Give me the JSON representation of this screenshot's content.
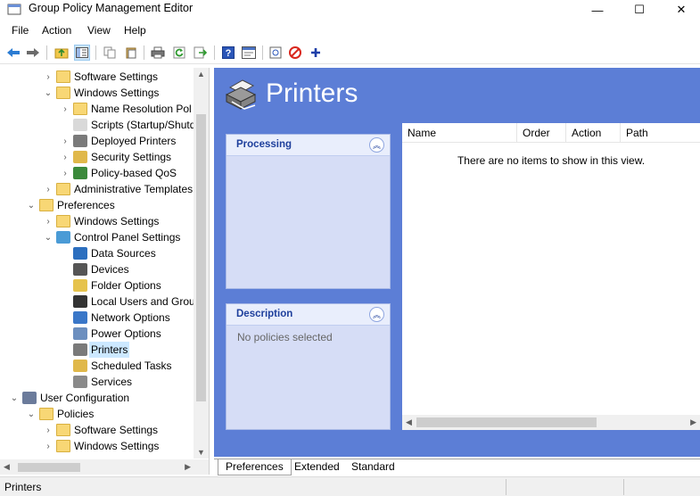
{
  "window": {
    "title": "Group Policy Management Editor",
    "minimize_glyph": "—",
    "maximize_glyph": "☐",
    "close_glyph": "✕"
  },
  "menu": [
    "File",
    "Action",
    "View",
    "Help"
  ],
  "toolbar": {
    "icons": [
      "back-icon",
      "forward-icon",
      "up-folder-icon",
      "show-hide-tree-icon",
      "copy-icon",
      "paste-icon",
      "print-icon",
      "refresh-icon",
      "export-icon",
      "help-icon",
      "properties-icon",
      "new-item-icon",
      "stop-icon",
      "add-icon"
    ]
  },
  "tree": {
    "items": [
      {
        "label": "Software Settings",
        "icon": "folder-icon",
        "expander": "›"
      },
      {
        "label": "Windows Settings",
        "icon": "folder-icon",
        "expander": "⌄"
      },
      {
        "label": "Name Resolution Pol",
        "icon": "folder-icon",
        "expander": "›"
      },
      {
        "label": "Scripts (Startup/Shutd",
        "icon": "script-icon",
        "expander": ""
      },
      {
        "label": "Deployed Printers",
        "icon": "printer-icon",
        "expander": "›"
      },
      {
        "label": "Security Settings",
        "icon": "security-icon",
        "expander": "›"
      },
      {
        "label": "Policy-based QoS",
        "icon": "chart-icon",
        "expander": "›"
      },
      {
        "label": "Administrative Templates",
        "icon": "folder-icon",
        "expander": "›"
      },
      {
        "label": "Preferences",
        "icon": "folder-icon",
        "expander": "⌄"
      },
      {
        "label": "Windows Settings",
        "icon": "folder-icon",
        "expander": "›"
      },
      {
        "label": "Control Panel Settings",
        "icon": "control-panel-icon",
        "expander": "⌄"
      },
      {
        "label": "Data Sources",
        "icon": "data-sources-icon",
        "expander": ""
      },
      {
        "label": "Devices",
        "icon": "devices-icon",
        "expander": ""
      },
      {
        "label": "Folder Options",
        "icon": "folder-options-icon",
        "expander": ""
      },
      {
        "label": "Local Users and Grou",
        "icon": "users-icon",
        "expander": ""
      },
      {
        "label": "Network Options",
        "icon": "network-icon",
        "expander": ""
      },
      {
        "label": "Power Options",
        "icon": "power-icon",
        "expander": ""
      },
      {
        "label": "Printers",
        "icon": "printer-icon",
        "expander": ""
      },
      {
        "label": "Scheduled Tasks",
        "icon": "scheduled-tasks-icon",
        "expander": ""
      },
      {
        "label": "Services",
        "icon": "services-icon",
        "expander": ""
      },
      {
        "label": "User Configuration",
        "icon": "user-config-icon",
        "expander": "⌄"
      },
      {
        "label": "Policies",
        "icon": "folder-icon",
        "expander": "⌄"
      },
      {
        "label": "Software Settings",
        "icon": "folder-icon",
        "expander": "›"
      },
      {
        "label": "Windows Settings",
        "icon": "folder-icon",
        "expander": "›"
      }
    ],
    "selected": "Printers"
  },
  "main": {
    "title": "Printers",
    "processing_title": "Processing",
    "description_title": "Description",
    "description_text": "No policies selected",
    "collapse_glyph": "︽",
    "columns": [
      "Name",
      "Order",
      "Action",
      "Path"
    ],
    "empty_message": "There are no items to show in this view."
  },
  "tabs": [
    "Preferences",
    "Extended",
    "Standard"
  ],
  "status": {
    "text": "Printers"
  }
}
